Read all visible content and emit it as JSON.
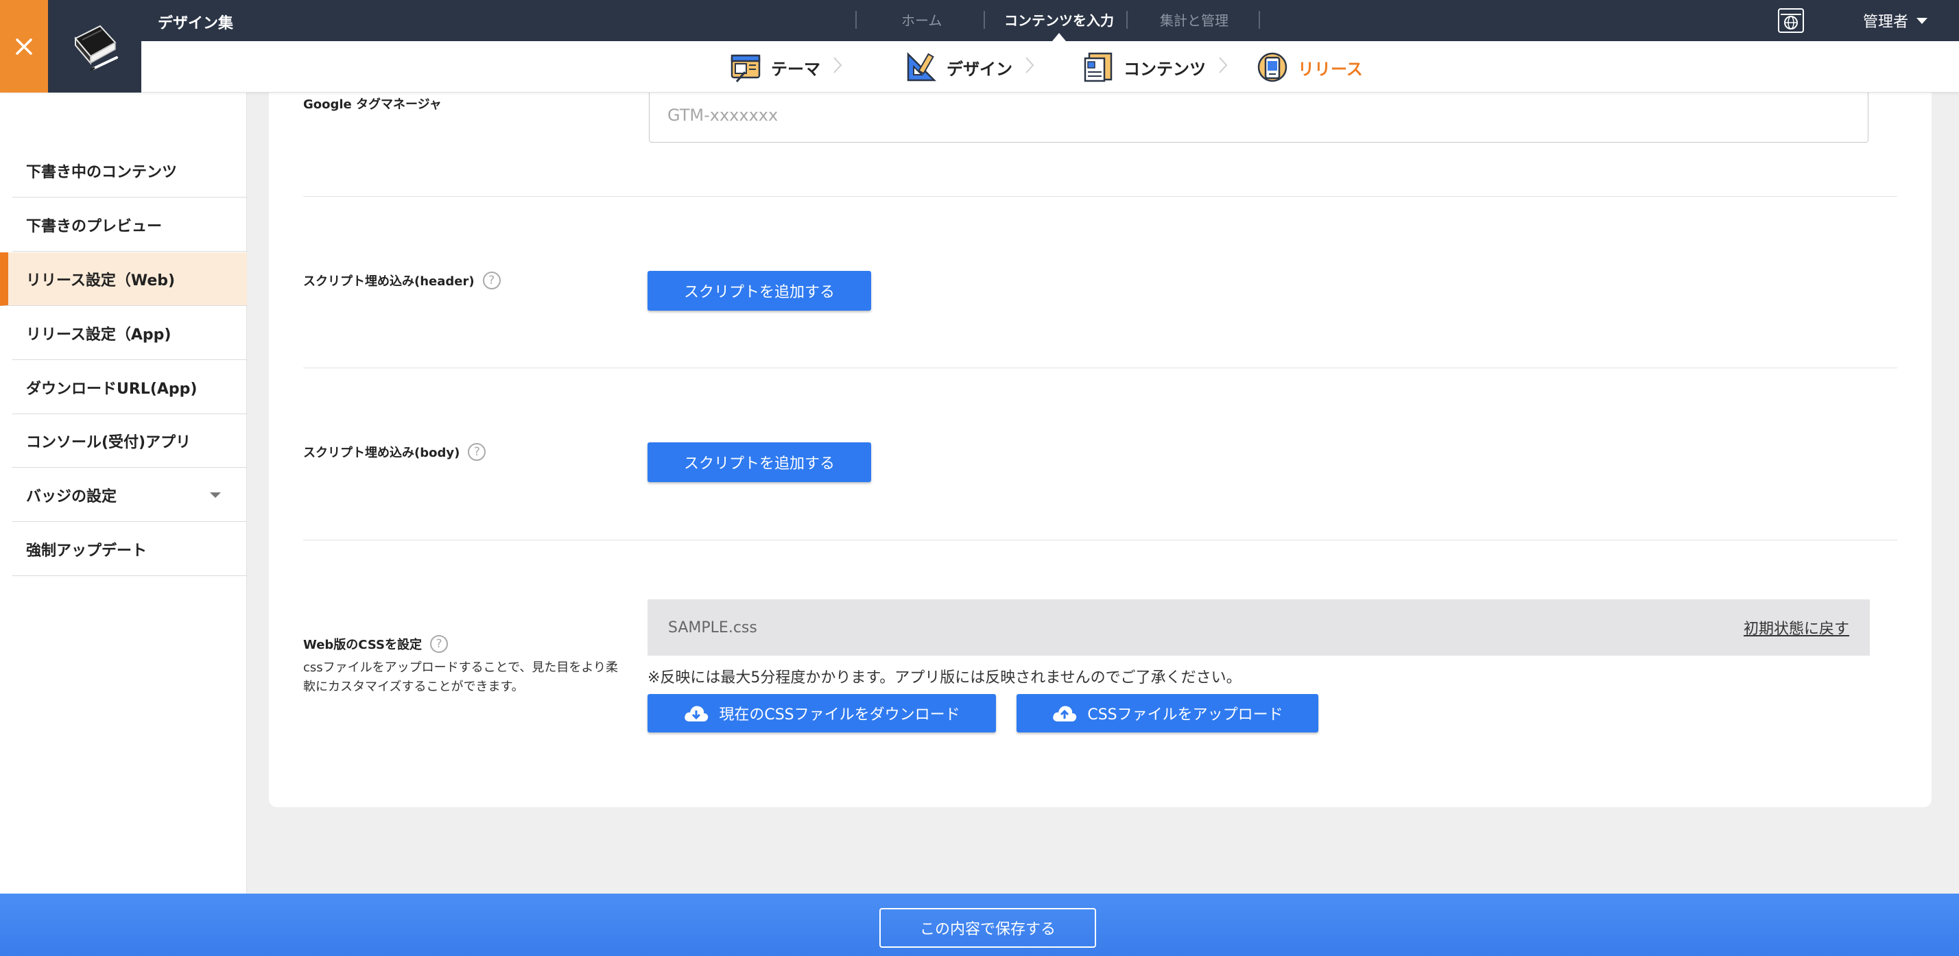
{
  "header": {
    "app_title": "デザイン集",
    "nav": [
      "ホーム",
      "コンテンツを入力",
      "集計と管理"
    ],
    "active_nav": "コンテンツを入力",
    "user": "管理者"
  },
  "steps": [
    {
      "label": "テーマ",
      "icon": "theme-icon"
    },
    {
      "label": "デザイン",
      "icon": "design-icon"
    },
    {
      "label": "コンテンツ",
      "icon": "contents-icon"
    },
    {
      "label": "リリース",
      "icon": "release-icon",
      "current": true
    }
  ],
  "sidebar": {
    "items": [
      {
        "label": "下書き中のコンテンツ"
      },
      {
        "label": "下書きのプレビュー"
      },
      {
        "label": "リリース設定（Web)",
        "active": true
      },
      {
        "label": "リリース設定（App)"
      },
      {
        "label": "ダウンロードURL(App)"
      },
      {
        "label": "コンソール(受付)アプリ"
      },
      {
        "label": "バッジの設定",
        "expandable": true
      },
      {
        "label": "強制アップデート"
      }
    ]
  },
  "form": {
    "gtm": {
      "label": "Google タグマネージャ",
      "placeholder": "GTM-xxxxxxx",
      "value": ""
    },
    "script_header": {
      "label": "スクリプト埋め込み(header)",
      "button": "スクリプトを追加する"
    },
    "script_body": {
      "label": "スクリプト埋め込み(body)",
      "button": "スクリプトを追加する"
    },
    "css": {
      "label": "Web版のCSSを設定",
      "description": "cssファイルをアップロードすることで、見た目をより柔軟にカスタマイズすることができます。",
      "file_name": "SAMPLE.css",
      "reset_label": "初期状態に戻す",
      "note": "※反映には最大5分程度かかります。アプリ版には反映されませんのでご了承ください。",
      "download_button": "現在のCSSファイルをダウンロード",
      "upload_button": "CSSファイルをアップロード"
    }
  },
  "footer": {
    "save_label": "この内容で保存する"
  },
  "help_glyph": "?",
  "colors": {
    "accent": "#ef7b1f",
    "primary": "#2f7af0",
    "topbar": "#2b3546",
    "active_bg": "#fdebd9"
  }
}
